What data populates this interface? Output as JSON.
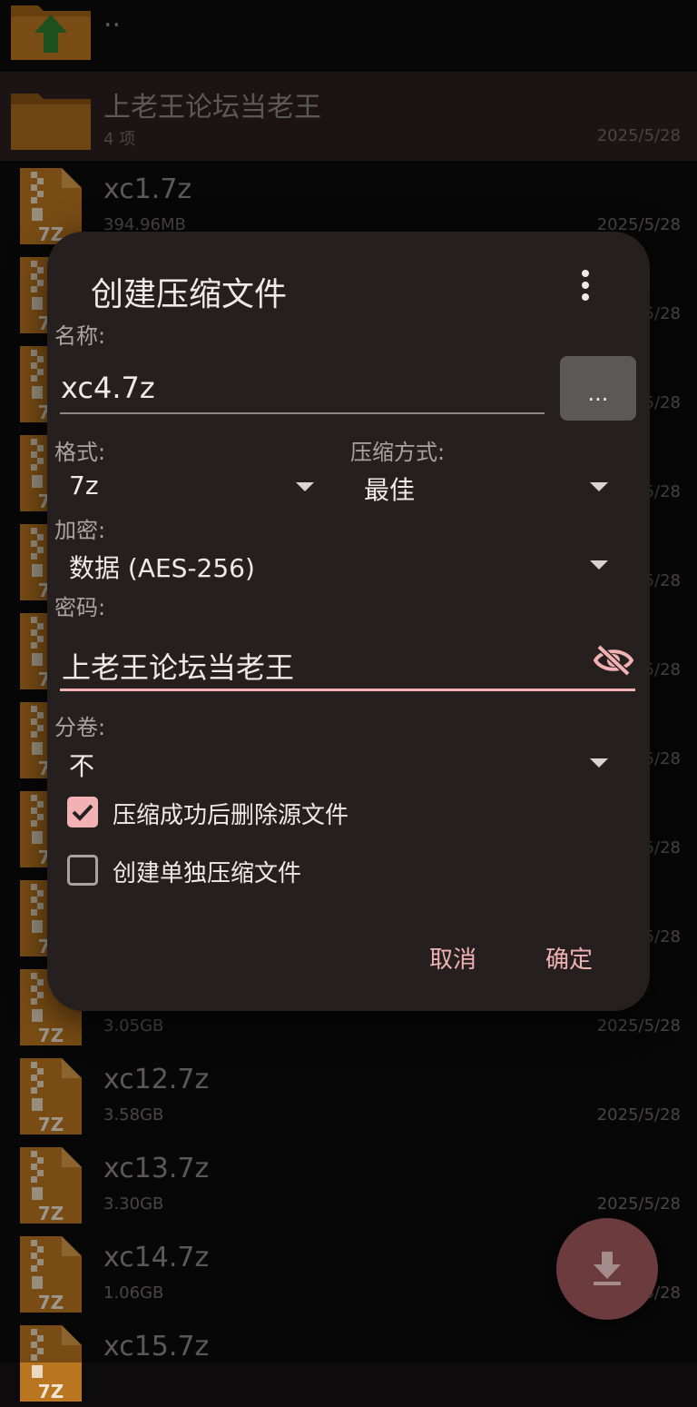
{
  "file_list": {
    "parent_label": "..",
    "folder": {
      "name": "上老王论坛当老王",
      "meta": "4 项",
      "date": "2025/5/28"
    },
    "files": [
      {
        "name": "xc1.7z",
        "meta": "394.96MB",
        "date": "2025/5/28"
      },
      {
        "name": "",
        "meta": "",
        "date": "2025/5/28"
      },
      {
        "name": "",
        "meta": "",
        "date": "2025/5/28"
      },
      {
        "name": "",
        "meta": "",
        "date": "2025/5/28"
      },
      {
        "name": "",
        "meta": "",
        "date": "2025/5/28"
      },
      {
        "name": "",
        "meta": "",
        "date": "2025/5/28"
      },
      {
        "name": "",
        "meta": "",
        "date": "2025/5/28"
      },
      {
        "name": "",
        "meta": "",
        "date": "2025/5/28"
      },
      {
        "name": "",
        "meta": "",
        "date": "2025/5/28"
      },
      {
        "name": "",
        "meta": "3.05GB",
        "date": "2025/5/28"
      },
      {
        "name": "xc12.7z",
        "meta": "3.58GB",
        "date": "2025/5/28"
      },
      {
        "name": "xc13.7z",
        "meta": "3.30GB",
        "date": "2025/5/28"
      },
      {
        "name": "xc14.7z",
        "meta": "1.06GB",
        "date": "2025/5/28"
      },
      {
        "name": "xc15.7z",
        "meta": "",
        "date": ""
      }
    ],
    "archive_icon_text": "7Z"
  },
  "dialog": {
    "title": "创建压缩文件",
    "name_label": "名称:",
    "name_value": "xc4.7z",
    "browse_label": "...",
    "format_label": "格式:",
    "format_value": "7z",
    "method_label": "压缩方式:",
    "method_value": "最佳",
    "encryption_label": "加密:",
    "encryption_value": "数据 (AES-256)",
    "password_label": "密码:",
    "password_value": "上老王论坛当老王",
    "split_label": "分卷:",
    "split_value": "不",
    "delete_source_label": "压缩成功后删除源文件",
    "delete_source_checked": true,
    "separate_archives_label": "创建单独压缩文件",
    "separate_archives_checked": false,
    "cancel_label": "取消",
    "ok_label": "确定"
  },
  "colors": {
    "accent": "#f2b2b4",
    "dialog_bg": "#261f20",
    "folder": "#b9751f",
    "fab": "#6b3b3d"
  }
}
